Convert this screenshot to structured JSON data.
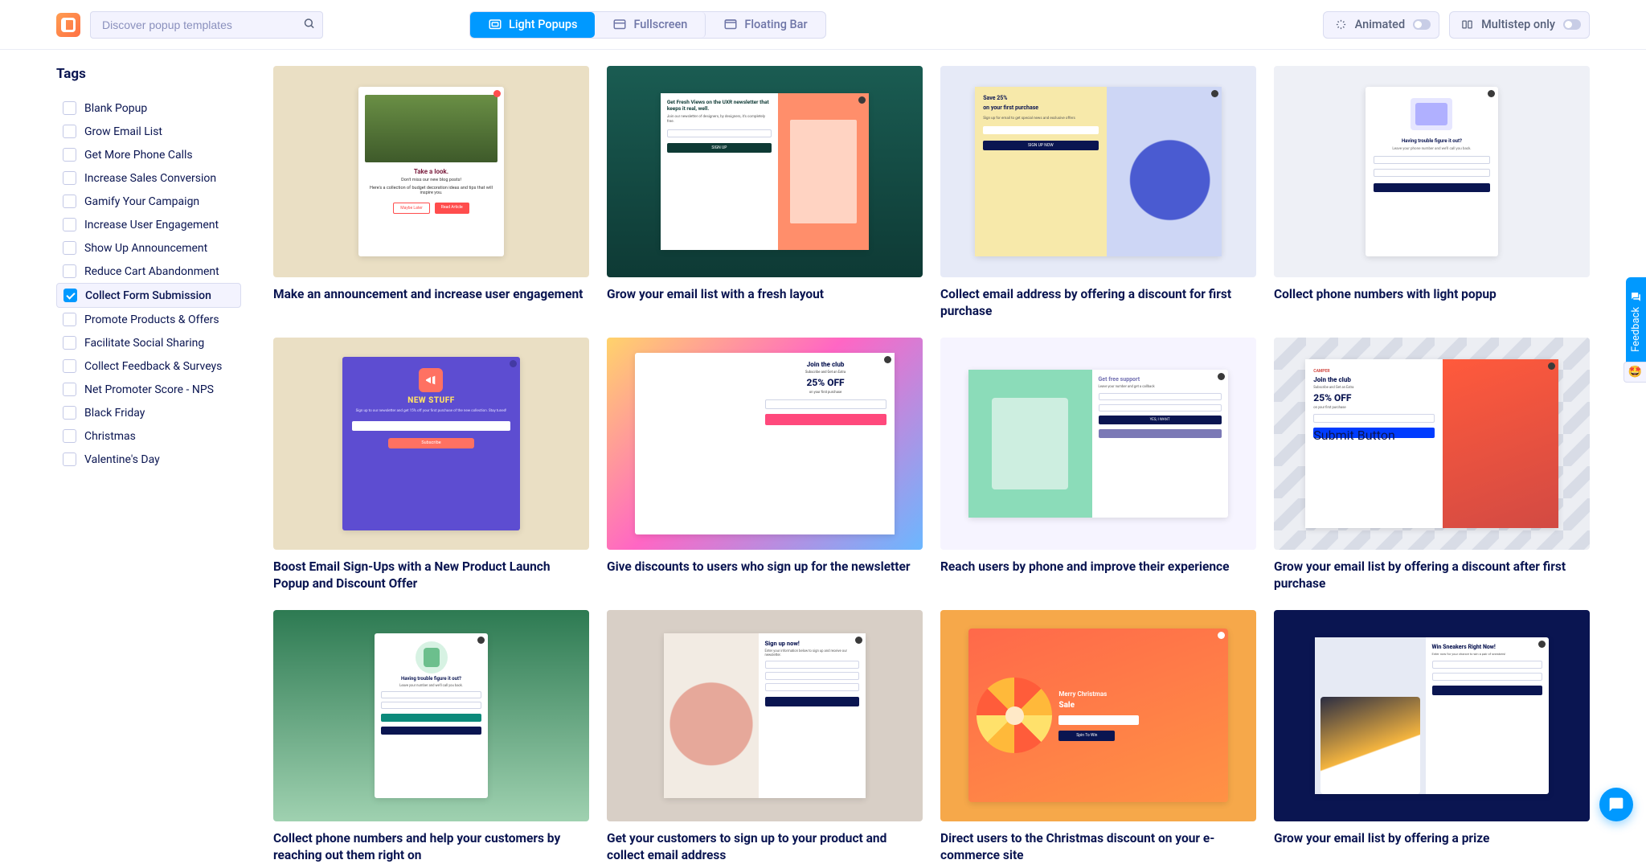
{
  "search": {
    "placeholder": "Discover popup templates"
  },
  "tabs": [
    {
      "label": "Light Popups",
      "active": true
    },
    {
      "label": "Fullscreen",
      "active": false
    },
    {
      "label": "Floating Bar",
      "active": false
    }
  ],
  "toggles": [
    {
      "label": "Animated"
    },
    {
      "label": "Multistep only"
    }
  ],
  "sidebar": {
    "title": "Tags",
    "items": [
      {
        "label": "Blank Popup",
        "checked": false
      },
      {
        "label": "Grow Email List",
        "checked": false
      },
      {
        "label": "Get More Phone Calls",
        "checked": false
      },
      {
        "label": "Increase Sales Conversion",
        "checked": false
      },
      {
        "label": "Gamify Your Campaign",
        "checked": false
      },
      {
        "label": "Increase User Engagement",
        "checked": false
      },
      {
        "label": "Show Up Announcement",
        "checked": false
      },
      {
        "label": "Reduce Cart Abandonment",
        "checked": false
      },
      {
        "label": "Collect Form Submission",
        "checked": true
      },
      {
        "label": "Promote Products & Offers",
        "checked": false
      },
      {
        "label": "Facilitate Social Sharing",
        "checked": false
      },
      {
        "label": "Collect Feedback & Surveys",
        "checked": false
      },
      {
        "label": "Net Promoter Score - NPS",
        "checked": false
      },
      {
        "label": "Black Friday",
        "checked": false
      },
      {
        "label": "Christmas",
        "checked": false
      },
      {
        "label": "Valentine's Day",
        "checked": false
      }
    ]
  },
  "cards": [
    {
      "title": "Make an announcement and increase user engagement",
      "popup": {
        "title": "Take a look.",
        "sub": "Don't miss our new blog posts!",
        "body": "Here's a collection of budget decoration ideas and tips that will inspire you.",
        "btn1": "Maybe Later",
        "btn2": "Read Article"
      }
    },
    {
      "title": "Grow your email list with a fresh layout",
      "popup": {
        "hd": "Get Fresh Views on the UXR newsletter that keeps it real, well.",
        "tx": "Join our newsletter of designers, by designers, it's completely free.",
        "cta": "SIGN UP"
      }
    },
    {
      "title": "Collect email address by offering a discount for first purchase",
      "popup": {
        "hd1": "Save 25%",
        "hd2": "on your first purchase",
        "tx": "Sign up for email to get special news and exclusive offers",
        "cta": "SIGN UP NOW"
      }
    },
    {
      "title": "Collect phone numbers with light popup",
      "popup": {
        "hd": "Having trouble figure it out?",
        "tx": "Leave your phone number and we'll call you back."
      }
    },
    {
      "title": "Boost Email Sign-Ups with a New Product Launch Popup and Discount Offer",
      "popup": {
        "hd": "NEW STUFF",
        "tx": "Sign up to our newsletter and get 15% off your first purchase of the new collection. Stay tuned!",
        "cta": "Subscribe"
      }
    },
    {
      "title": "Give discounts to users who sign up for the newsletter",
      "popup": {
        "hd": "Join the club",
        "tx": "Subscribe and Get an Extra",
        "big": "25% OFF",
        "tx2": "on your first purchase"
      }
    },
    {
      "title": "Reach users by phone and improve their experience",
      "popup": {
        "hd": "Get free support",
        "tx": "Leave your number and get a callback",
        "cta": "YES, I WANT",
        "cta2": ""
      }
    },
    {
      "title": "Grow your email list by offering a discount after first purchase",
      "popup": {
        "lg": "CAMPER",
        "hd": "Join the club",
        "tx": "Subscribe and Get an Extra",
        "big": "25% OFF",
        "tx2": "on your first purchase",
        "cta": "Submit Button"
      }
    },
    {
      "title": "Collect phone numbers and help your customers by reaching out them right on",
      "popup": {
        "hd": "Having trouble figure it out?",
        "tx": "Leave your number and we'll call you back."
      }
    },
    {
      "title": "Get your customers to sign up to your product and collect email address",
      "popup": {
        "hd": "Sign up now!",
        "tx": "Enter your information below to sign up and receive our newsletter."
      }
    },
    {
      "title": "Direct users to the Christmas discount on your e-commerce site",
      "popup": {
        "l1": "Merry Christmas",
        "l2": "Sale",
        "cta": "Spin To Win"
      }
    },
    {
      "title": "Grow your email list by offering a prize",
      "popup": {
        "hd": "Win Sneakers Right Now!",
        "tx": "Enter now for your chance to win a pair of sneakers!"
      }
    }
  ],
  "feedback": {
    "label": "Feedback"
  }
}
